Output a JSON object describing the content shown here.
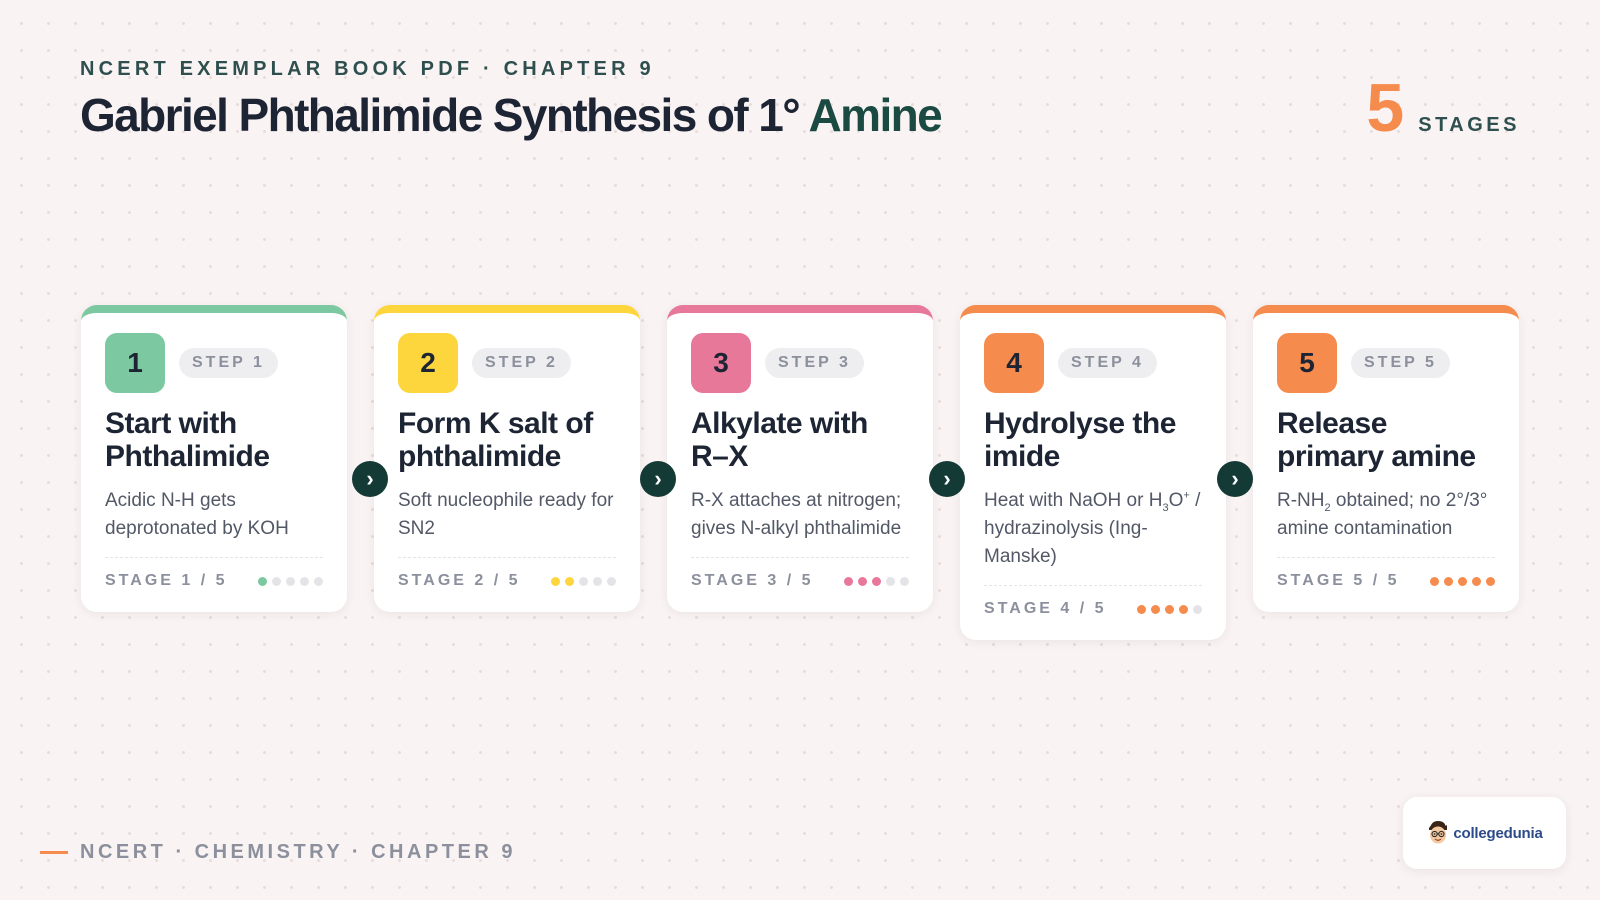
{
  "header": {
    "eyebrow": "NCERT EXEMPLAR BOOK PDF · CHAPTER 9",
    "title_main": "Gabriel Phthalimide Synthesis of 1°",
    "title_accent": "Amine",
    "stage_count": "5",
    "stage_label": "STAGES"
  },
  "colors": {
    "green": "#7cc8a0",
    "yellow": "#fdd63d",
    "pink": "#e7789a",
    "orange": "#f58b4c",
    "dark": "#143a36"
  },
  "cards": [
    {
      "num": "1",
      "badge": "STEP 1",
      "color": "#7cc8a0",
      "title": "Start with Phthalimide",
      "desc": "Acidic N-H gets deprotonated by KOH",
      "stage": "STAGE 1 / 5",
      "filled": 1
    },
    {
      "num": "2",
      "badge": "STEP 2",
      "color": "#fdd63d",
      "title": "Form K salt of phthalimide",
      "desc": "Soft nucleophile ready for SN2",
      "stage": "STAGE 2 / 5",
      "filled": 2
    },
    {
      "num": "3",
      "badge": "STEP 3",
      "color": "#e7789a",
      "title": "Alkylate with R–X",
      "desc": "R-X attaches at nitrogen; gives N-alkyl phthalimide",
      "stage": "STAGE 3 / 5",
      "filled": 3
    },
    {
      "num": "4",
      "badge": "STEP 4",
      "color": "#f58b4c",
      "title": "Hydrolyse the imide",
      "desc_pre": "Heat with NaOH or H",
      "desc_sub": "3",
      "desc_mid": "O",
      "desc_sup": "+",
      "desc_post": " / hydrazinolysis (Ing-Manske)",
      "stage": "STAGE 4 / 5",
      "filled": 4
    },
    {
      "num": "5",
      "badge": "STEP 5",
      "color": "#f58b4c",
      "title": "Release primary amine",
      "desc_pre": "R-NH",
      "desc_sub": "2",
      "desc_post": " obtained; no 2°/3° amine contamination",
      "stage": "STAGE 5 / 5",
      "filled": 5
    }
  ],
  "total_stages": 5,
  "arrow_glyph": "›",
  "footer": {
    "text": "NCERT · CHEMISTRY · CHAPTER 9"
  },
  "logo": {
    "text": "collegedunia",
    "icon": "mascot-icon"
  }
}
